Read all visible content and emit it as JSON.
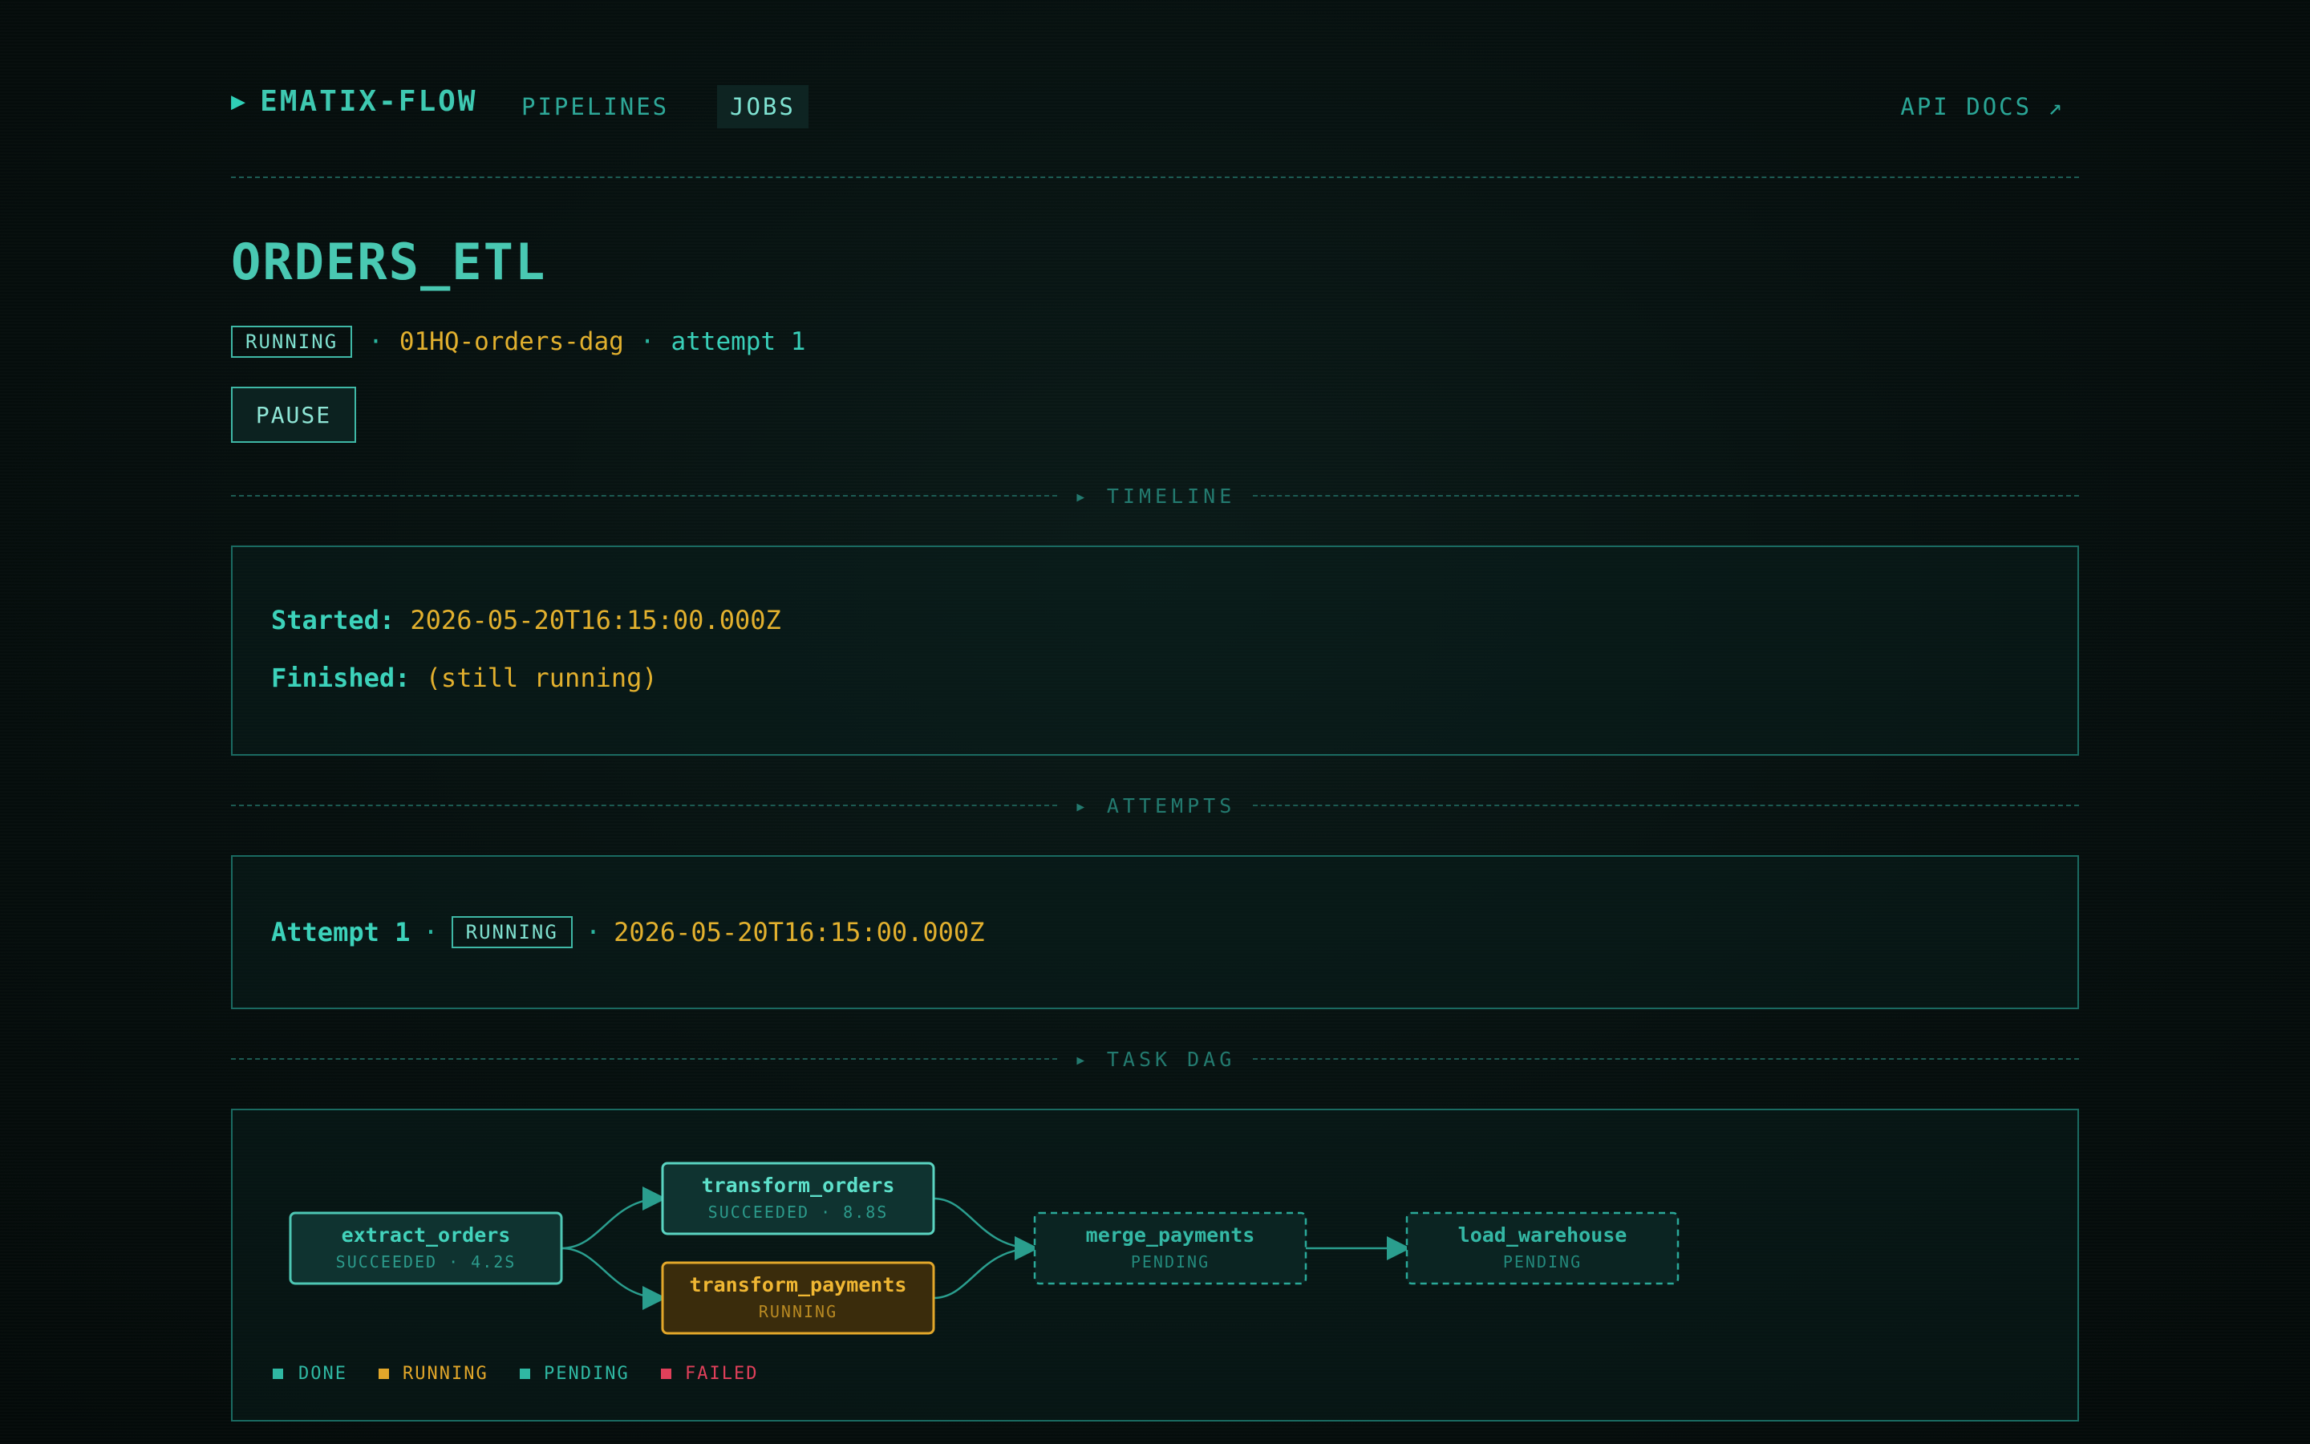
{
  "header": {
    "brand": "EMATIX-FLOW",
    "nav": [
      {
        "label": "PIPELINES"
      },
      {
        "label": "JOBS"
      }
    ],
    "api_docs": "API DOCS ↗"
  },
  "job": {
    "title": "ORDERS_ETL",
    "status": "RUNNING",
    "dag_id": "01HQ-orders-dag",
    "attempt": "attempt 1",
    "pause_label": "PAUSE"
  },
  "timeline": {
    "section_label": "▸ TIMELINE",
    "started_label": "Started:",
    "started_value": "2026-05-20T16:15:00.000Z",
    "finished_label": "Finished:",
    "finished_value": "(still running)"
  },
  "attempts": {
    "section_label": "▸ ATTEMPTS",
    "items": [
      {
        "label": "Attempt 1",
        "status": "RUNNING",
        "time": "2026-05-20T16:15:00.000Z"
      }
    ]
  },
  "dag": {
    "section_label": "▸ TASK DAG",
    "nodes": [
      {
        "name": "extract_orders",
        "status": "SUCCEEDED · 4.2S",
        "state": "done"
      },
      {
        "name": "transform_orders",
        "status": "SUCCEEDED · 8.8S",
        "state": "done"
      },
      {
        "name": "transform_payments",
        "status": "RUNNING",
        "state": "running"
      },
      {
        "name": "merge_payments",
        "status": "PENDING",
        "state": "pending"
      },
      {
        "name": "load_warehouse",
        "status": "PENDING",
        "state": "pending"
      }
    ],
    "legend": [
      {
        "label": "DONE",
        "color": "#2fb8a3"
      },
      {
        "label": "RUNNING",
        "color": "#e2a72a"
      },
      {
        "label": "PENDING",
        "color": "#2fb8a3"
      },
      {
        "label": "FAILED",
        "color": "#e0405a"
      }
    ]
  },
  "colors": {
    "accent": "#2fcfb6",
    "amber": "#e2b02e",
    "background": "#050d0c",
    "failed": "#e0405a"
  }
}
